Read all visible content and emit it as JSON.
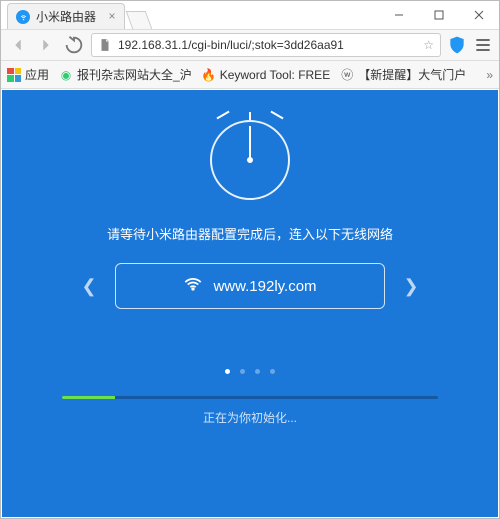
{
  "window": {
    "tab_title": "小米路由器",
    "controls": {
      "min": "—",
      "max": "□",
      "close": "×"
    }
  },
  "address_bar": {
    "url": "192.168.31.1/cgi-bin/luci/;stok=3dd26aa91"
  },
  "bookmarks": {
    "apps_label": "应用",
    "items": [
      {
        "label": "报刊杂志网站大全_沪"
      },
      {
        "label": "Keyword Tool: FREE"
      },
      {
        "label": "【新提醒】大气门户"
      }
    ]
  },
  "page": {
    "instruction": "请等待小米路由器配置完成后，连入以下无线网络",
    "ssid": "www.192ly.com",
    "status": "正在为你初始化...",
    "dot_count": 4,
    "active_dot": 1,
    "progress_percent": 14
  },
  "colors": {
    "accent": "#1b77d8",
    "progress": "#6ee04c"
  }
}
